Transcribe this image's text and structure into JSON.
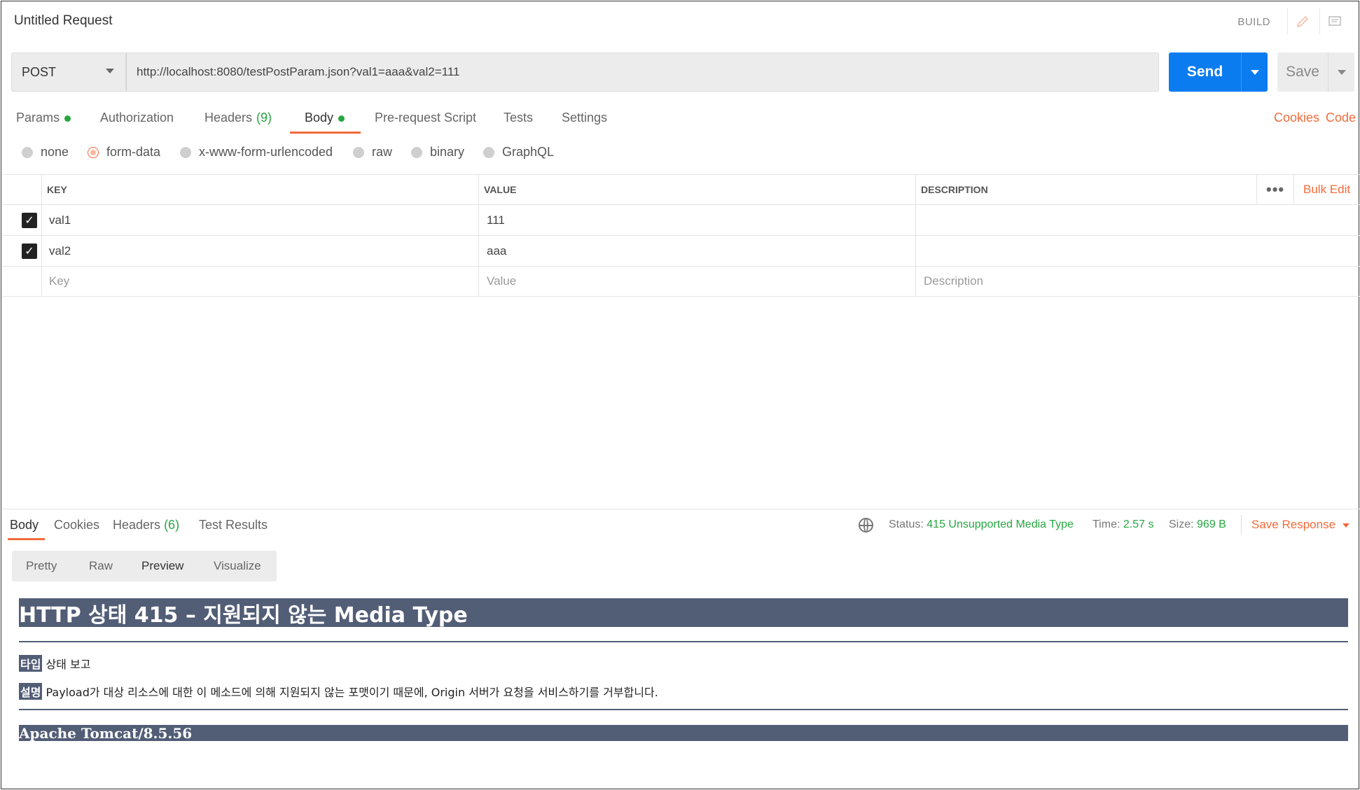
{
  "header": {
    "title": "Untitled Request",
    "build": "BUILD"
  },
  "request": {
    "method": "POST",
    "url": "http://localhost:8080/testPostParam.json?val1=aaa&val2=111",
    "send_label": "Send",
    "save_label": "Save"
  },
  "tabs": {
    "params": "Params",
    "authorization": "Authorization",
    "headers": "Headers",
    "headers_count": "(9)",
    "body": "Body",
    "pre_request": "Pre-request Script",
    "tests": "Tests",
    "settings": "Settings",
    "cookies": "Cookies",
    "code": "Code"
  },
  "body_types": {
    "none": "none",
    "form_data": "form-data",
    "urlencoded": "x-www-form-urlencoded",
    "raw": "raw",
    "binary": "binary",
    "graphql": "GraphQL",
    "selected": "form-data"
  },
  "table": {
    "headers": {
      "key": "KEY",
      "value": "VALUE",
      "description": "DESCRIPTION",
      "bulk_edit": "Bulk Edit",
      "more": "•••"
    },
    "rows": [
      {
        "checked": true,
        "key": "val1",
        "value": "111",
        "description": ""
      },
      {
        "checked": true,
        "key": "val2",
        "value": "aaa",
        "description": ""
      }
    ],
    "placeholder": {
      "key": "Key",
      "value": "Value",
      "description": "Description"
    }
  },
  "response": {
    "tabs": {
      "body": "Body",
      "cookies": "Cookies",
      "headers": "Headers",
      "headers_count": "(6)",
      "test_results": "Test Results"
    },
    "status_label": "Status:",
    "status_value": "415 Unsupported Media Type",
    "time_label": "Time:",
    "time_value": "2.57 s",
    "size_label": "Size:",
    "size_value": "969 B",
    "save_response": "Save Response",
    "views": {
      "pretty": "Pretty",
      "raw": "Raw",
      "preview": "Preview",
      "visualize": "Visualize",
      "selected": "Preview"
    }
  },
  "preview": {
    "heading": "HTTP 상태 415 – 지원되지 않는 Media Type",
    "type_label": "타입",
    "type_text": "상태 보고",
    "desc_label": "설명",
    "desc_text": "Payload가 대상 리소스에 대한 이 메소드에 의해 지원되지 않는 포맷이기 때문에, Origin 서버가 요청을 서비스하기를 거부합니다.",
    "footer": "Apache Tomcat/8.5.56"
  },
  "colors": {
    "accent": "#f26b3a",
    "primary": "#0a7cf0",
    "success": "#26a641",
    "tomcat": "#525d76"
  }
}
